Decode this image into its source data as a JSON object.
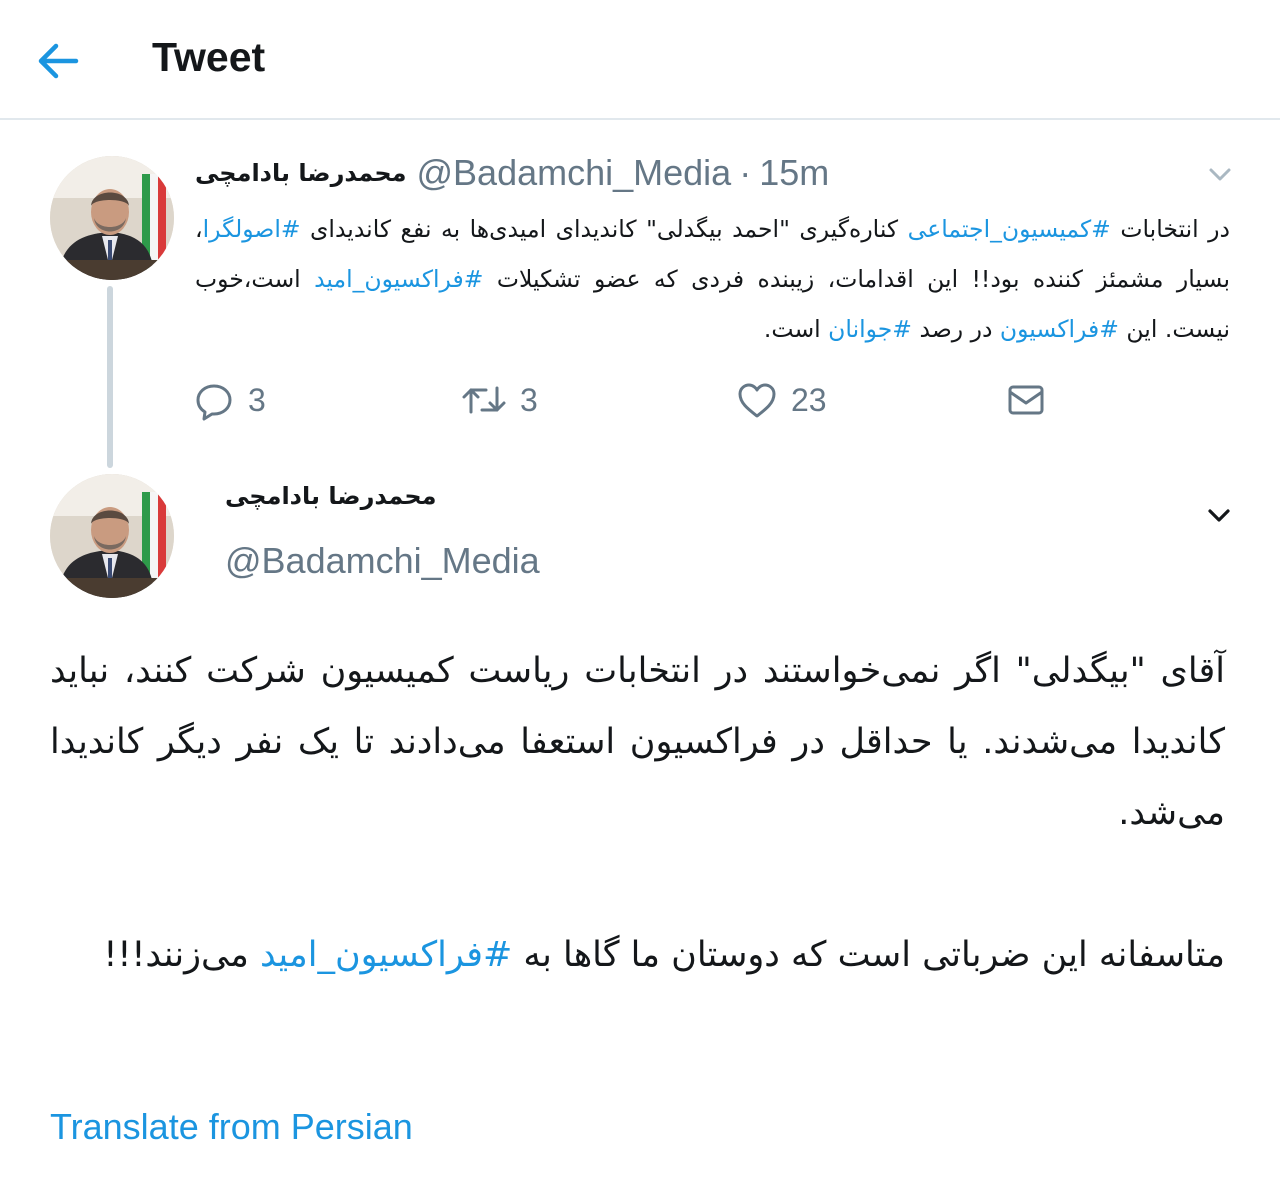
{
  "header": {
    "title": "Tweet",
    "back_icon": "arrow-left-icon",
    "accent_color": "#1b95e0"
  },
  "tweet_parent": {
    "author_name": "محمدرضا بادامچی",
    "handle": "@Badamchi_Media",
    "separator": "·",
    "time": "15m",
    "text_parts": [
      {
        "t": "در انتخابات "
      },
      {
        "t": "#کمیسیون_اجتماعی",
        "tag": true
      },
      {
        "t": " کناره‌گیری \"احمد بیگدلی\" کاندیدای امیدی‌ها به نفع کاندیدای "
      },
      {
        "t": "#اصولگرا",
        "tag": true
      },
      {
        "t": "، بسیار مشمئز کننده بود!! این اقدامات، زیبنده فردی که عضو تشکیلات "
      },
      {
        "t": "#فراکسیون_امید",
        "tag": true
      },
      {
        "t": " است،خوب نیست. این "
      },
      {
        "t": "#فراکسیون",
        "tag": true
      },
      {
        "t": " در رصد "
      },
      {
        "t": "#جوانان",
        "tag": true
      },
      {
        "t": " است."
      }
    ],
    "actions": {
      "reply_count": "3",
      "retweet_count": "3",
      "like_count": "23"
    }
  },
  "tweet_main": {
    "author_name": "محمدرضا بادامچی",
    "handle": "@Badamchi_Media",
    "paragraph1": "آقای \"بیگدلی\" اگر نمی‌خواستند در انتخابات ریاست کمیسیون شرکت کنند، نباید کاندیدا می‌شدند. یا حداقل در فراکسیون استعفا می‌دادند تا یک نفر دیگر کاندیدا می‌شد.",
    "paragraph2_before": "متاسفانه این ضرباتی است که دوستان ما گاها به ",
    "paragraph2_tag": "#فراکسیون_امید",
    "paragraph2_after": " می‌زنند!!!",
    "translate_link": "Translate from Persian"
  }
}
